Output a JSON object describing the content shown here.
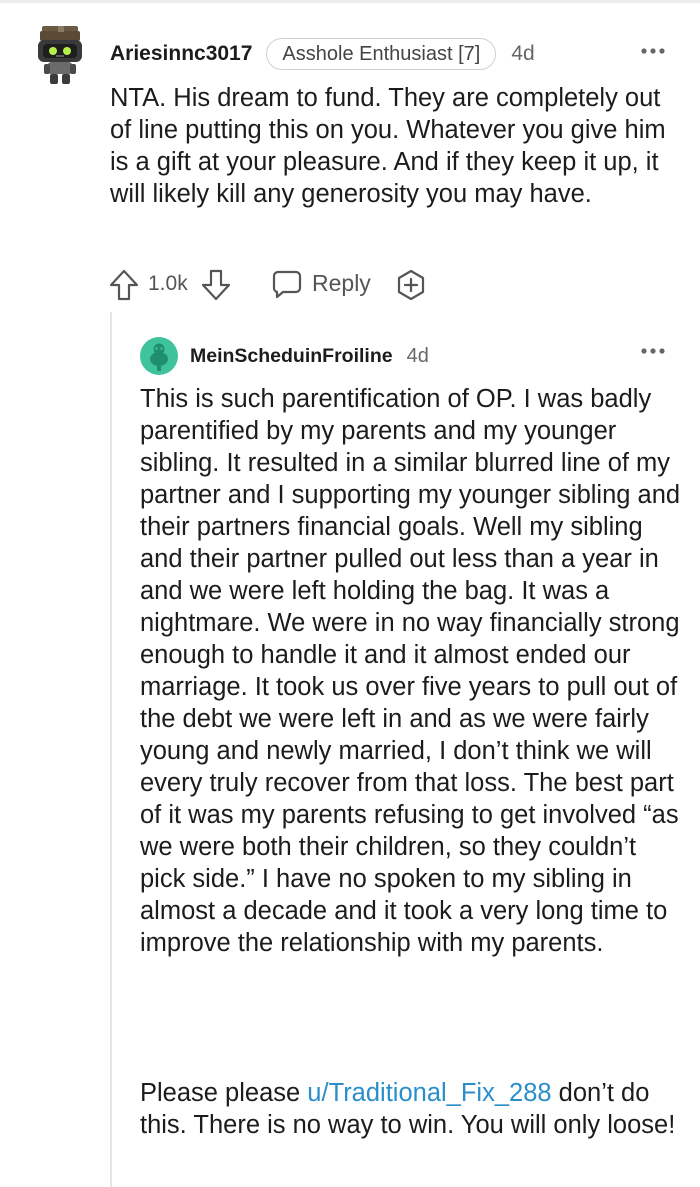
{
  "comments": [
    {
      "username": "Ariesinnc3017",
      "flair": "Asshole Enthusiast [7]",
      "age": "4d",
      "body": "NTA. His dream to fund. They are completely out of line putting this on you. Whatever you give him is a gift at your pleasure. And if they keep it up, it will likely kill any generosity you may have.",
      "score": "1.0k",
      "reply_label": "Reply"
    },
    {
      "username": "MeinScheduinFroiline",
      "age": "4d",
      "body": "This is such parentification of OP. I was badly parentified by my parents and my younger sibling. It resulted in a similar blurred line of my partner and I supporting my younger sibling and their partners financial goals. Well my sibling and their partner pulled out less than a year in and we were left holding the bag. It was a nightmare. We were in no way financially strong enough to handle it and it almost ended our marriage. It took us over five years to pull out of the debt we were left in and as we were fairly young and newly married, I don’t think we will every truly recover from that loss. The best part of it was my parents refusing to get involved “as we were both their children, so they couldn’t pick side.” I have no spoken to my sibling in almost a decade and it took a very long time to improve the relationship with my parents.",
      "body2_before": "Please please ",
      "mention": "u/Traditional_Fix_288",
      "body2_after": " don’t do this. There is no way to win. You will only loose!"
    }
  ],
  "icons": {
    "avatar1": "robot-avatar-icon",
    "avatar2": "snoo-avatar-icon",
    "more": "more-options-icon",
    "upvote": "upvote-arrow-icon",
    "downvote": "downvote-arrow-icon",
    "reply": "reply-bubble-icon",
    "award": "award-plus-icon"
  },
  "colors": {
    "mention": "#2a8fc9",
    "avatar2": "#3ec39d"
  }
}
